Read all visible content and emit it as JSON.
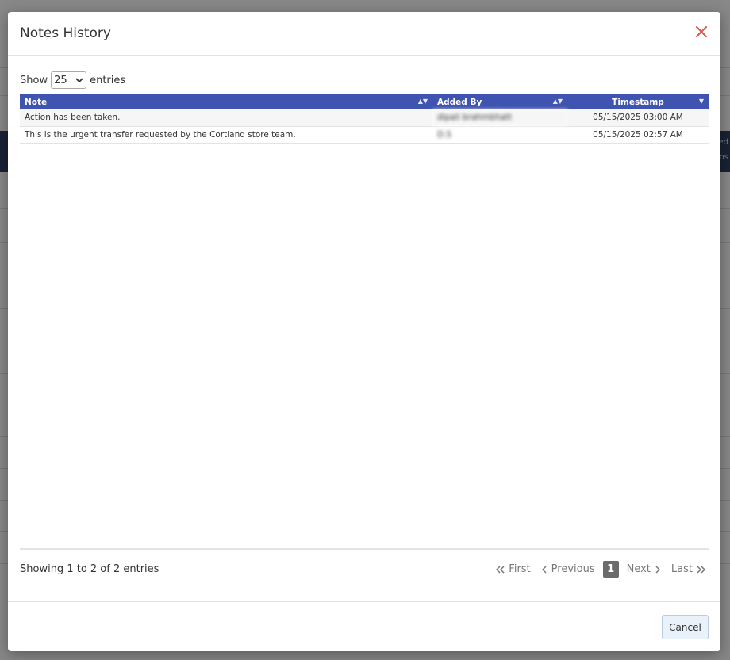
{
  "modal": {
    "title": "Notes History",
    "close_icon": "close-icon",
    "accent_color": "#3f53b0",
    "close_color": "#d9534f"
  },
  "length": {
    "show_label": "Show",
    "selected": "25",
    "entries_label": "entries"
  },
  "table": {
    "columns": [
      "Note",
      "Added By",
      "Timestamp"
    ],
    "rows": [
      {
        "note": "Action has been taken.",
        "added_by": "dipali brahmbhatt",
        "timestamp": "05/15/2025 03:00 AM"
      },
      {
        "note": "This is the urgent transfer requested by the Cortland store team.",
        "added_by": "D.S",
        "timestamp": "05/15/2025 02:57 AM"
      }
    ]
  },
  "info": "Showing 1 to 2 of 2 entries",
  "pager": {
    "first": "First",
    "previous": "Previous",
    "current": "1",
    "next": "Next",
    "last": "Last"
  },
  "footer": {
    "cancel_label": "Cancel"
  },
  "background": {
    "edge_text_1": "ed",
    "edge_text_2": "os"
  }
}
